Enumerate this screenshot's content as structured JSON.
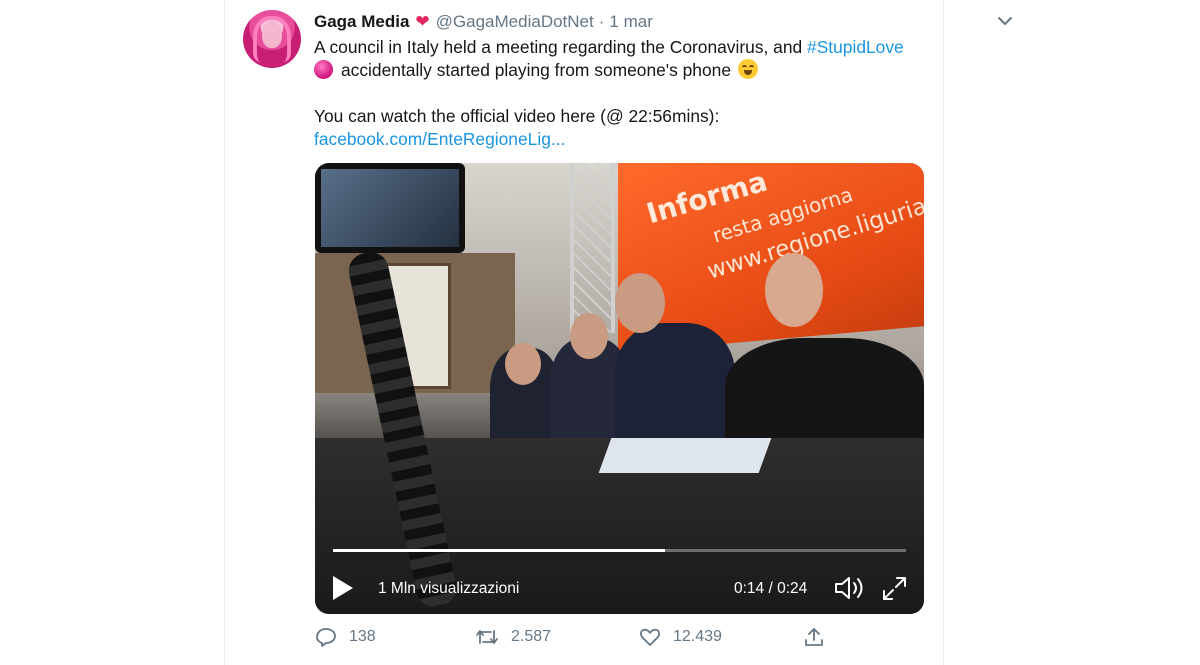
{
  "tweet": {
    "author_name": "Gaga Media",
    "author_handle": "@GagaMediaDotNet",
    "separator": "·",
    "date": "1 mar",
    "text_line1": "A council in Italy held a meeting regarding the Coronavirus, and ",
    "hashtag": "#StupidLove",
    "text_line2": "accidentally started playing from someone's phone",
    "text_line3": "You can watch the official video here (@ 22:56mins):",
    "link": "facebook.com/EnteRegioneLig...",
    "icons": {
      "verified_emoji": "heart-emoji-icon",
      "orb": "pink-orb-emoji-icon",
      "laugh": "tears-of-joy-emoji-icon",
      "menu": "chevron-down-icon"
    }
  },
  "video": {
    "banner_text1": "Informa",
    "banner_text2": "resta aggiorna",
    "banner_text3": "www.regione.liguria.",
    "progress": 0.58,
    "views": "1 Mln visualizzazioni",
    "time": "0:14 / 0:24",
    "icons": {
      "play": "play-icon",
      "volume": "volume-icon",
      "fullscreen": "fullscreen-icon"
    }
  },
  "actions": {
    "replies": "138",
    "retweets": "2.587",
    "likes": "12.439",
    "icons": [
      "reply-icon",
      "retweet-icon",
      "like-icon",
      "share-icon"
    ]
  },
  "colors": {
    "link": "#1b95e0",
    "heart": "#e0245e",
    "muted": "#657786"
  }
}
